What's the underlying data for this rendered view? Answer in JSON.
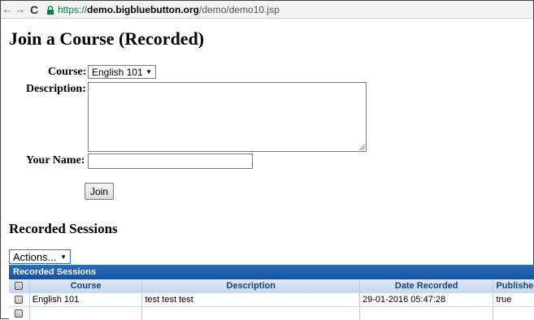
{
  "browser": {
    "url_secure": "https://",
    "url_host": "demo.bigbluebutton.org",
    "url_path": "/demo/demo10.jsp"
  },
  "page": {
    "title": "Join a Course (Recorded)"
  },
  "form": {
    "course_label": "Course:",
    "course_value": "English 101",
    "description_label": "Description:",
    "description_value": "",
    "name_label": "Your Name:",
    "name_value": "",
    "join_button": "Join"
  },
  "recordings": {
    "section_title": "Recorded Sessions",
    "actions_label": "Actions...",
    "grid_caption": "Recorded Sessions",
    "columns": [
      "Course",
      "Description",
      "Date Recorded",
      "Published"
    ],
    "rows": [
      {
        "course": "English 101",
        "description": "test test test",
        "date": "29-01-2016 05:47:28",
        "published": "true"
      }
    ]
  }
}
